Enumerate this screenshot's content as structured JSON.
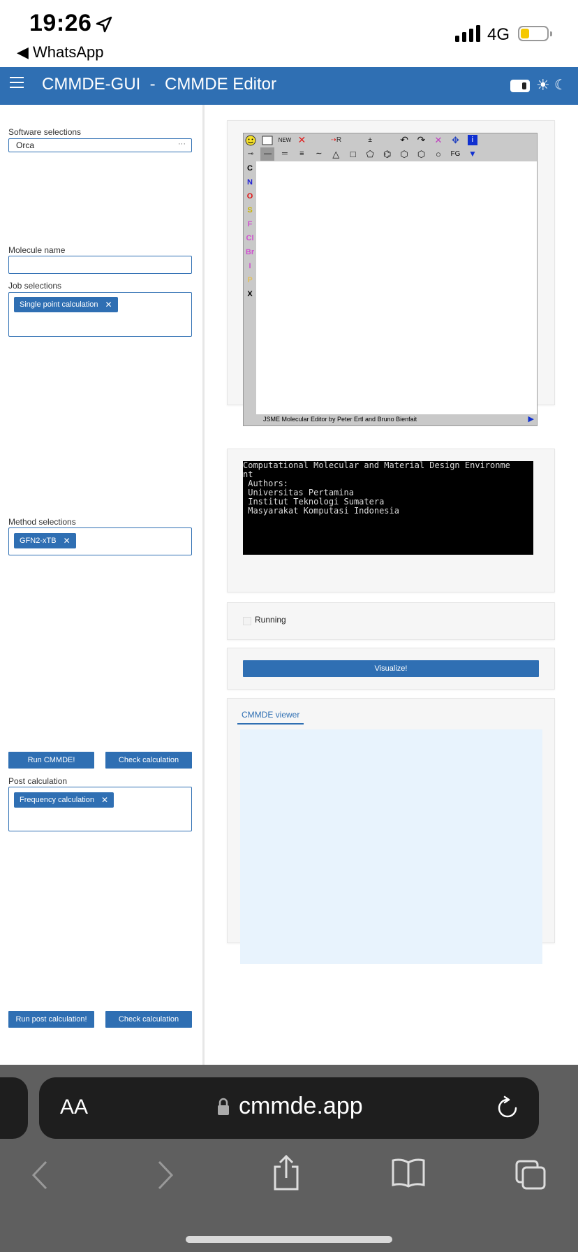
{
  "status_bar": {
    "time": "19:26",
    "back_app": "WhatsApp",
    "network": "4G"
  },
  "app": {
    "title": "CMMDE-GUI  -  CMMDE Editor"
  },
  "sidebar": {
    "software_label": "Software selections",
    "software_value": "Orca",
    "molecule_label": "Molecule name",
    "job_label": "Job selections",
    "job_tag": "Single point calculation",
    "method_label": "Method selections",
    "method_tag": "GFN2-xTB",
    "run_button": "Run CMMDE!",
    "check_button": "Check calculation",
    "post_label": "Post calculation",
    "post_tag": "Frequency calculation",
    "run_post_button": "Run post calculation!",
    "check_post_button": "Check calculation"
  },
  "jsme": {
    "footer": "JSME Molecular Editor by Peter Ertl and Bruno Bienfait",
    "top_row": [
      "NEW",
      "R",
      "FG"
    ],
    "atoms": [
      {
        "s": "C",
        "c": "#000000"
      },
      {
        "s": "N",
        "c": "#1f1fd6"
      },
      {
        "s": "O",
        "c": "#e01010"
      },
      {
        "s": "S",
        "c": "#c8b400"
      },
      {
        "s": "F",
        "c": "#d050d0"
      },
      {
        "s": "Cl",
        "c": "#d050d0"
      },
      {
        "s": "Br",
        "c": "#d050d0"
      },
      {
        "s": "I",
        "c": "#d050d0"
      },
      {
        "s": "P",
        "c": "#e0c060"
      },
      {
        "s": "X",
        "c": "#000000"
      }
    ]
  },
  "console": {
    "lines": [
      "Computational Molecular and Material Design Environme",
      "nt",
      " Authors:",
      " Universitas Pertamina",
      " Institut Teknologi Sumatera",
      " Masyarakat Komputasi Indonesia"
    ]
  },
  "running_label": "Running",
  "visualize_button": "Visualize!",
  "viewer_tab": "CMMDE viewer",
  "safari": {
    "aa": "AA",
    "url": "cmmde.app"
  }
}
